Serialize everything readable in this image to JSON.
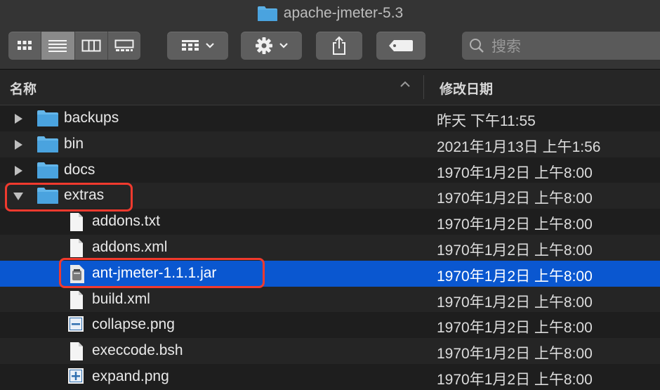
{
  "window": {
    "title": "apache-jmeter-5.3"
  },
  "toolbar": {
    "view_icons": [
      "icon-view-icon",
      "list-view-icon",
      "column-view-icon",
      "gallery-view-icon"
    ],
    "search_placeholder": "搜索"
  },
  "header": {
    "name": "名称",
    "date_modified": "修改日期"
  },
  "rows": [
    {
      "name": "backups",
      "date": "昨天 下午11:55",
      "type": "folder",
      "expanded": false
    },
    {
      "name": "bin",
      "date": "2021年1月13日 上午1:56",
      "type": "folder",
      "expanded": false
    },
    {
      "name": "docs",
      "date": "1970年1月2日 上午8:00",
      "type": "folder",
      "expanded": false
    },
    {
      "name": "extras",
      "date": "1970年1月2日 上午8:00",
      "type": "folder",
      "expanded": true
    },
    {
      "name": "addons.txt",
      "date": "1970年1月2日 上午8:00",
      "type": "doc"
    },
    {
      "name": "addons.xml",
      "date": "1970年1月2日 上午8:00",
      "type": "doc"
    },
    {
      "name": "ant-jmeter-1.1.1.jar",
      "date": "1970年1月2日 上午8:00",
      "type": "jar",
      "selected": true
    },
    {
      "name": "build.xml",
      "date": "1970年1月2日 上午8:00",
      "type": "doc"
    },
    {
      "name": "collapse.png",
      "date": "1970年1月2日 上午8:00",
      "type": "image-minus"
    },
    {
      "name": "execcode.bsh",
      "date": "1970年1月2日 上午8:00",
      "type": "doc"
    },
    {
      "name": "expand.png",
      "date": "1970年1月2日 上午8:00",
      "type": "image-plus"
    }
  ],
  "colors": {
    "selection": "#0a57d0",
    "annotation": "#f03a2e",
    "folder": "#4aa3df"
  }
}
